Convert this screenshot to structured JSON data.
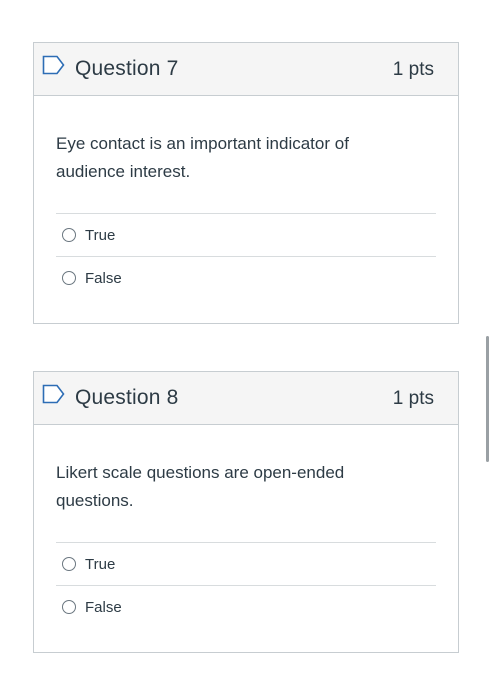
{
  "questions": [
    {
      "title": "Question 7",
      "points": "1 pts",
      "text": "Eye contact is an important indicator of audience interest.",
      "answers": [
        {
          "label": "True"
        },
        {
          "label": "False"
        }
      ]
    },
    {
      "title": "Question 8",
      "points": "1 pts",
      "text": "Likert scale questions are open-ended questions.",
      "answers": [
        {
          "label": "True"
        },
        {
          "label": "False"
        }
      ]
    }
  ],
  "icons": {
    "flag": "flag-icon",
    "radio": "radio-button"
  },
  "colors": {
    "header_bg": "#f5f5f5",
    "border": "#c7cdd1",
    "flag_stroke": "#2d6db5",
    "text": "#2d3b45"
  }
}
